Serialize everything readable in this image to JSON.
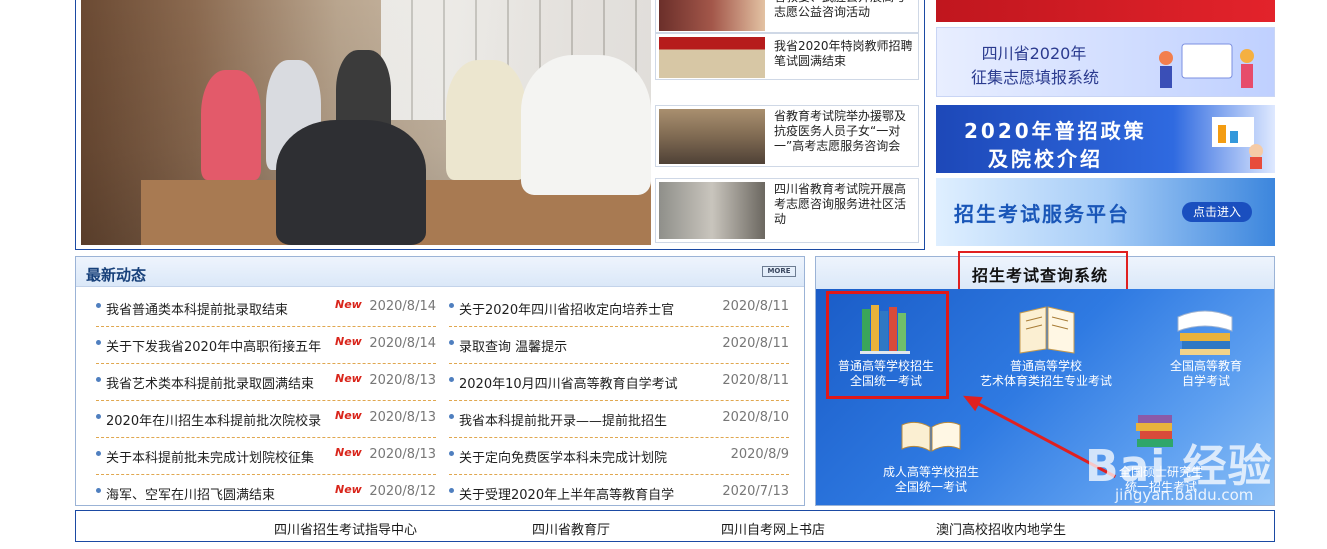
{
  "top_news": [
    {
      "text": "省教育考试院举办援鄂抗疫医务人员子女\"一对一\"高考志愿服务咨询会"
    },
    {
      "text": "我省2020年特岗教师招聘笔试圆满结束"
    },
    {
      "text": "省教育考试院举办援鄂及抗疫医务人员子女“一对一”高考志愿服务咨询会"
    },
    {
      "text": "四川省教育考试院开展高考志愿咨询服务进社区活动"
    }
  ],
  "top_news_partial": "省教委、武胜县开展高考志愿公益咨询活动",
  "side_banners": {
    "b1_line1": "四川省2020年",
    "b1_line2": "征集志愿填报系统",
    "b2_line1": "2020年普招政策",
    "b2_line2": "及院校介绍",
    "b3_title": "招生考试服务平台",
    "b3_button": "点击进入"
  },
  "news": {
    "title": "最新动态",
    "more_label": "MORE",
    "left": [
      {
        "title": "我省普通类本科提前批录取结束",
        "new": "New",
        "date": "2020/8/14"
      },
      {
        "title": "关于下发我省2020年中高职衔接五年",
        "new": "New",
        "date": "2020/8/14"
      },
      {
        "title": "我省艺术类本科提前批录取圆满结束",
        "new": "New",
        "date": "2020/8/13"
      },
      {
        "title": "2020年在川招生本科提前批次院校录",
        "new": "New",
        "date": "2020/8/13"
      },
      {
        "title": "关于本科提前批未完成计划院校征集",
        "new": "New",
        "date": "2020/8/13"
      },
      {
        "title": "海军、空军在川招飞圆满结束",
        "new": "New",
        "date": "2020/8/12"
      }
    ],
    "right": [
      {
        "title": "关于2020年四川省招收定向培养士官",
        "date": "2020/8/11"
      },
      {
        "title": "录取查询 温馨提示",
        "date": "2020/8/11"
      },
      {
        "title": "2020年10月四川省高等教育自学考试",
        "date": "2020/8/11"
      },
      {
        "title": "我省本科提前批开录——提前批招生",
        "date": "2020/8/10"
      },
      {
        "title": "关于定向免费医学本科未完成计划院",
        "date": "2020/8/9"
      },
      {
        "title": "关于受理2020年上半年高等教育自学",
        "date": "2020/7/13"
      }
    ]
  },
  "query": {
    "title": "招生考试查询系统",
    "items": [
      {
        "line1": "普通高等学校招生",
        "line2": "全国统一考试"
      },
      {
        "line1": "普通高等学校",
        "line2": "艺术体育类招生专业考试"
      },
      {
        "line1": "全国高等教育",
        "line2": "自学考试"
      },
      {
        "line1": "成人高等学校招生",
        "line2": "全国统一考试"
      },
      {
        "line1": "全国硕士研究生",
        "line2": "统一招生考试"
      }
    ]
  },
  "watermark": {
    "logo": "Bai 经验",
    "url": "jingyan.baidu.com"
  },
  "footer_links": [
    "四川省招生考试指导中心",
    "四川省教育厅",
    "四川自考网上书店",
    "澳门高校招收内地学生"
  ],
  "colors": {
    "primary": "#1b4aa3",
    "new_red": "#d9261c",
    "highlight_red": "#e02020"
  }
}
